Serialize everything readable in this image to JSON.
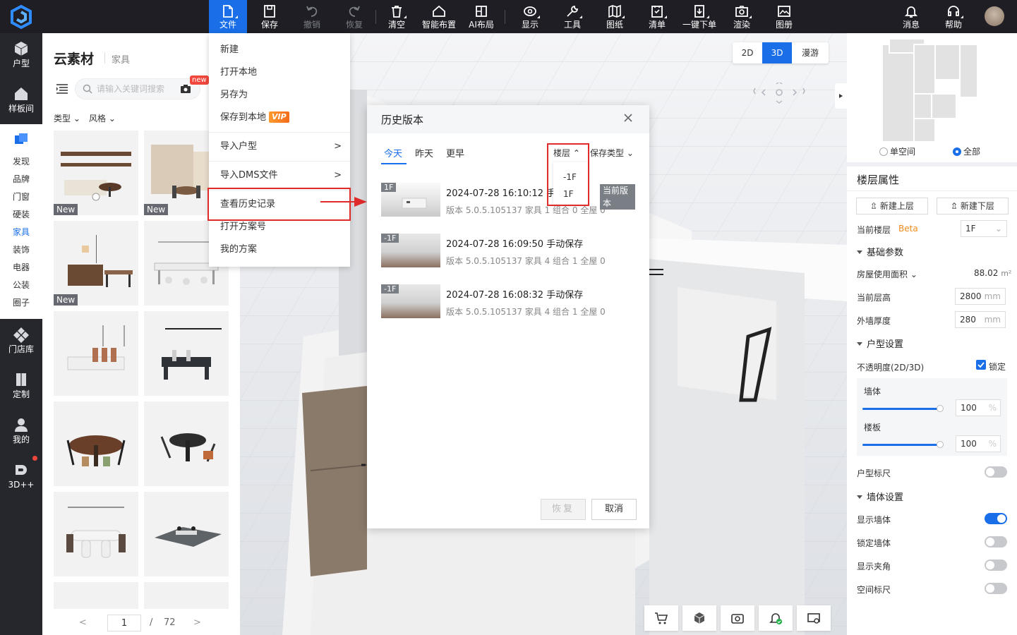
{
  "toolbar": {
    "items": [
      {
        "label": "文件"
      },
      {
        "label": "保存"
      },
      {
        "label": "撤销"
      },
      {
        "label": "恢复"
      },
      {
        "label": "清空"
      },
      {
        "label": "智能布置"
      },
      {
        "label": "AI布局"
      },
      {
        "label": "显示"
      },
      {
        "label": "工具"
      },
      {
        "label": "图纸"
      },
      {
        "label": "清单"
      },
      {
        "label": "一键下单"
      },
      {
        "label": "渲染"
      },
      {
        "label": "图册"
      },
      {
        "label": "消息"
      },
      {
        "label": "帮助"
      }
    ]
  },
  "leftnav": {
    "top": [
      {
        "label": "户型"
      },
      {
        "label": "样板间"
      }
    ],
    "sub": [
      {
        "label": "发现"
      },
      {
        "label": "品牌"
      },
      {
        "label": "门窗"
      },
      {
        "label": "硬装"
      },
      {
        "label": "家具"
      },
      {
        "label": "装饰"
      },
      {
        "label": "电器"
      },
      {
        "label": "公装"
      },
      {
        "label": "圈子"
      }
    ],
    "bottom": [
      {
        "label": "门店库"
      },
      {
        "label": "定制"
      },
      {
        "label": "我的"
      },
      {
        "label": "3D++"
      }
    ]
  },
  "materials": {
    "title": "云素材",
    "category": "家具",
    "search_placeholder": "请输入关键词搜索",
    "new_badge": "new",
    "filter_type": "类型",
    "filter_style": "风格",
    "thumb_badge": "New",
    "pager": {
      "prev": "<",
      "current": "1",
      "slash": "/",
      "total": "72",
      "next": ">"
    }
  },
  "filemenu": {
    "items": [
      {
        "label": "新建"
      },
      {
        "label": "打开本地"
      },
      {
        "label": "另存为"
      },
      {
        "label": "保存到本地"
      },
      {
        "label": "导入户型",
        "chev": ">"
      },
      {
        "label": "导入DMS文件",
        "chev": ">"
      },
      {
        "label": "查看历史记录"
      },
      {
        "label": "打开方案号"
      },
      {
        "label": "我的方案"
      }
    ],
    "vip": "VIP"
  },
  "viewmodes": {
    "m2d": "2D",
    "m3d": "3D",
    "walk": "漫游"
  },
  "history": {
    "title": "历史版本",
    "tabs": [
      {
        "label": "今天"
      },
      {
        "label": "昨天"
      },
      {
        "label": "更早"
      }
    ],
    "floor_filter": "楼层",
    "save_filter": "保存类型",
    "floor_options": [
      {
        "label": "-1F"
      },
      {
        "label": "1F"
      }
    ],
    "rows": [
      {
        "floor": "1F",
        "time": "2024-07-28 16:10:12",
        "type": "手动",
        "meta": "版本 5.0.5.105137  家具 1  组合 0  全屋 0",
        "current": "当前版本"
      },
      {
        "floor": "-1F",
        "time": "2024-07-28 16:09:50",
        "type": "手动保存",
        "meta": "版本 5.0.5.105137  家具 4  组合 1  全屋 0"
      },
      {
        "floor": "-1F",
        "time": "2024-07-28 16:08:32",
        "type": "手动保存",
        "meta": "版本 5.0.5.105137  家具 4  组合 1  全屋 0"
      }
    ],
    "restore": "恢复",
    "cancel": "取消"
  },
  "minimap": {
    "opt1": "单空间",
    "opt2": "全部"
  },
  "rightpanel": {
    "title": "楼层属性",
    "btn_up": "新建上层",
    "btn_down": "新建下层",
    "current_floor_label": "当前楼层",
    "beta": "Beta",
    "current_floor": "1F",
    "sec_basic": "基础参数",
    "area_label": "房屋使用面积",
    "area_value": "88.02",
    "area_unit": "m²",
    "height_label": "当前层高",
    "height_value": "2800",
    "mm": "mm",
    "wall_label": "外墙厚度",
    "wall_value": "280",
    "sec_house": "户型设置",
    "opacity_label": "不透明度(2D/3D)",
    "lock_label": "锁定",
    "wall_op_label": "墙体",
    "wall_op_value": "100",
    "floor_op_label": "楼板",
    "floor_op_value": "100",
    "pct": "%",
    "ruler_label": "户型标尺",
    "sec_wall": "墙体设置",
    "show_wall": "显示墙体",
    "lock_wall": "锁定墙体",
    "show_corner": "显示夹角",
    "space_ruler": "空间标尺"
  },
  "colors": {
    "accent": "#1a6fe8",
    "topbar": "#1e1e24",
    "highlight": "#e02b2b"
  }
}
